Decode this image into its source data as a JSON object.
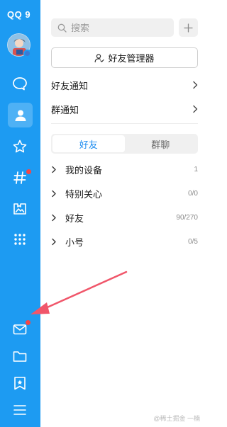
{
  "app": {
    "logo_text": "QQ 9"
  },
  "sidebar": {
    "items": [
      {
        "name": "messages",
        "icon": "chat-bubble-icon"
      },
      {
        "name": "contacts",
        "icon": "person-icon",
        "active": true
      },
      {
        "name": "favorites",
        "icon": "star-icon"
      },
      {
        "name": "channels",
        "icon": "hashtag-icon",
        "badge": true
      },
      {
        "name": "gallery",
        "icon": "bookmark-image-icon"
      },
      {
        "name": "apps",
        "icon": "grid-dots-icon"
      },
      {
        "name": "mail",
        "icon": "mail-icon",
        "badge": true
      },
      {
        "name": "files",
        "icon": "folder-icon"
      },
      {
        "name": "collection",
        "icon": "bookmark-star-icon"
      },
      {
        "name": "menu",
        "icon": "hamburger-menu-icon"
      }
    ]
  },
  "search": {
    "placeholder": "搜索"
  },
  "manager_button": {
    "label": "好友管理器"
  },
  "notifications": {
    "friend_notice": "好友通知",
    "group_notice": "群通知"
  },
  "tabs": [
    {
      "label": "好友",
      "active": true
    },
    {
      "label": "群聊",
      "active": false
    }
  ],
  "groups": [
    {
      "name": "我的设备",
      "count": "1"
    },
    {
      "name": "特别关心",
      "count": "0/0"
    },
    {
      "name": "好友",
      "count": "90/270"
    },
    {
      "name": "小号",
      "count": "0/5"
    }
  ],
  "watermark": "@稀土掘金  一楠",
  "colors": {
    "sidebar": "#1d9bf2",
    "accent": "#1d8cf0",
    "badge": "#f44747",
    "annotation_arrow": "#f0566a"
  }
}
